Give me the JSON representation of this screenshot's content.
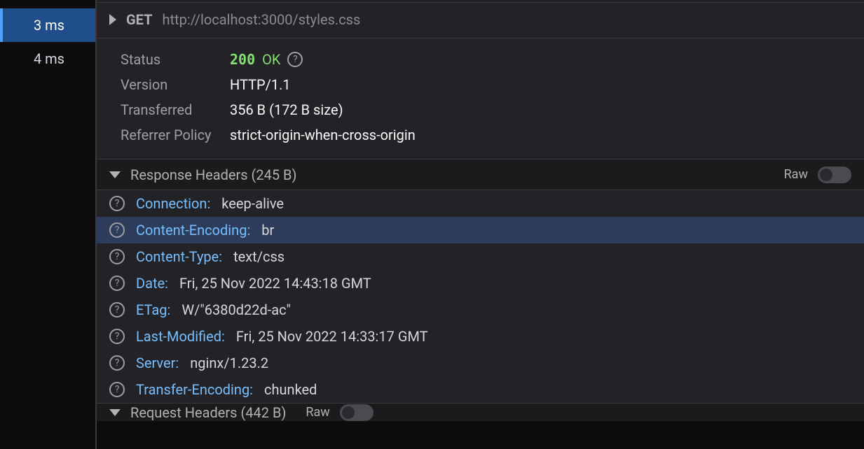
{
  "sidebar": {
    "items": [
      {
        "time": "3 ms",
        "selected": true
      },
      {
        "time": "4 ms",
        "selected": false
      }
    ]
  },
  "request": {
    "method": "GET",
    "url": "http://localhost:3000/styles.css"
  },
  "summary": {
    "status_label": "Status",
    "status_code": "200",
    "status_text": "OK",
    "version_label": "Version",
    "version_value": "HTTP/1.1",
    "transferred_label": "Transferred",
    "transferred_value": "356 B (172 B size)",
    "referrer_label": "Referrer Policy",
    "referrer_value": "strict-origin-when-cross-origin"
  },
  "response_section": {
    "title": "Response Headers (245 B)",
    "raw_label": "Raw",
    "headers": [
      {
        "name": "Connection",
        "value": "keep-alive",
        "highlight": false
      },
      {
        "name": "Content-Encoding",
        "value": "br",
        "highlight": true
      },
      {
        "name": "Content-Type",
        "value": "text/css",
        "highlight": false
      },
      {
        "name": "Date",
        "value": "Fri, 25 Nov 2022 14:43:18 GMT",
        "highlight": false
      },
      {
        "name": "ETag",
        "value": "W/\"6380d22d-ac\"",
        "highlight": false
      },
      {
        "name": "Last-Modified",
        "value": "Fri, 25 Nov 2022 14:33:17 GMT",
        "highlight": false
      },
      {
        "name": "Server",
        "value": "nginx/1.23.2",
        "highlight": false
      },
      {
        "name": "Transfer-Encoding",
        "value": "chunked",
        "highlight": false
      }
    ]
  },
  "request_section": {
    "title": "Request Headers (442 B)",
    "raw_label": "Raw"
  }
}
